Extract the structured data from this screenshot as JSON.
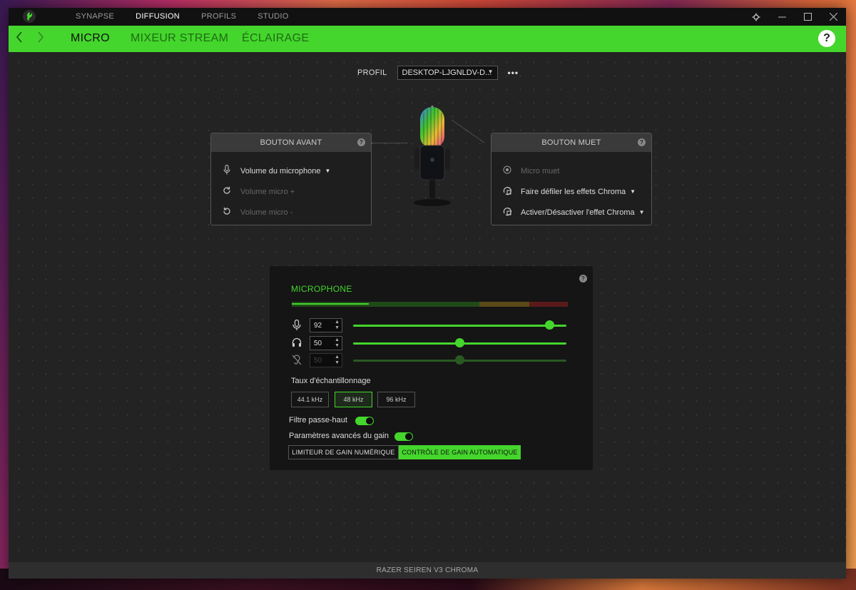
{
  "app": {
    "top_tabs": [
      "SYNAPSE",
      "DIFFUSION",
      "PROFILS",
      "STUDIO"
    ],
    "active_top_tab": "DIFFUSION",
    "logo_icon": "razer-logo-icon",
    "window_controls": [
      "settings-icon",
      "minimize-icon",
      "maximize-icon",
      "close-icon"
    ]
  },
  "nav": {
    "tabs": [
      "MICRO",
      "MIXEUR STREAM",
      "ÉCLAIRAGE"
    ],
    "active": "MICRO",
    "help": "?"
  },
  "profile": {
    "label": "PROFIL",
    "value": "DESKTOP-LJGNLDV-D...",
    "more": "•••"
  },
  "front_button": {
    "title": "BOUTON AVANT",
    "help": "?",
    "items": [
      {
        "label": "Volume du microphone",
        "icon": "microphone-icon",
        "enabled": true,
        "dropdown": true
      },
      {
        "label": "Volume micro +",
        "icon": "rotate-cw-icon",
        "enabled": false
      },
      {
        "label": "Volume micro -",
        "icon": "rotate-ccw-icon",
        "enabled": false
      }
    ]
  },
  "mute_button": {
    "title": "BOUTON MUET",
    "help": "?",
    "items": [
      {
        "label": "Micro muet",
        "icon": "radio-icon",
        "enabled": false
      },
      {
        "label": "Faire défiler les effets Chroma",
        "icon": "chroma-cycle-icon",
        "enabled": true,
        "dropdown": true
      },
      {
        "label": "Activer/Désactiver l'effet Chroma",
        "icon": "chroma-toggle-icon",
        "enabled": true,
        "dropdown": true
      }
    ]
  },
  "microphone": {
    "title": "MICROPHONE",
    "help": "?",
    "level_fraction": 0.28,
    "sliders": [
      {
        "name": "mic-gain",
        "icon": "microphone-icon",
        "value": "92",
        "level": 0.92,
        "enabled": true
      },
      {
        "name": "monitoring",
        "icon": "headphones-icon",
        "value": "50",
        "level": 0.5,
        "enabled": true
      },
      {
        "name": "sidetone",
        "icon": "ear-off-icon",
        "value": "50",
        "level": 0.5,
        "enabled": false
      }
    ],
    "sample_rate_label": "Taux d'échantillonnage",
    "sample_rates": [
      "44.1 kHz",
      "48 kHz",
      "96 kHz"
    ],
    "sample_rate_selected": "48 kHz",
    "high_pass_label": "Filtre passe-haut",
    "high_pass_on": true,
    "advanced_gain_label": "Paramètres avancés du gain",
    "advanced_gain_on": true,
    "gain_modes": [
      "LIMITEUR DE GAIN NUMÉRIQUE",
      "CONTRÔLE DE GAIN AUTOMATIQUE"
    ],
    "gain_mode_active": "CONTRÔLE DE GAIN AUTOMATIQUE"
  },
  "footer": {
    "device": "RAZER SEIREN V3 CHROMA"
  },
  "colors": {
    "accent": "#44d62c",
    "panel": "#151515",
    "background": "#232323"
  }
}
